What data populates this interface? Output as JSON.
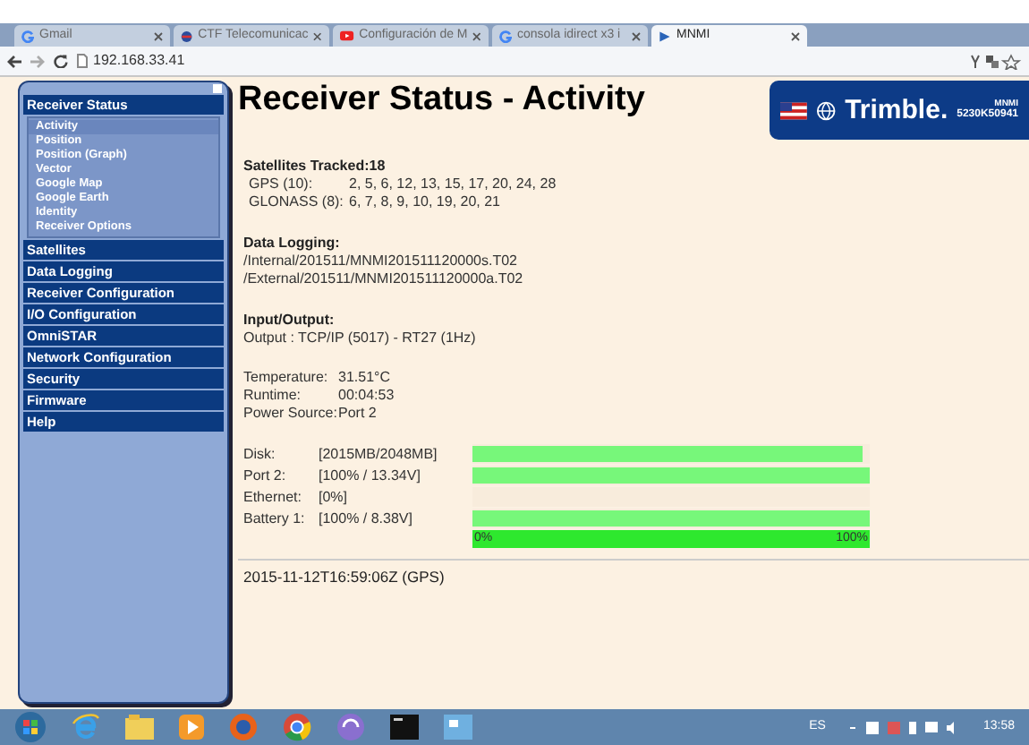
{
  "browser": {
    "tabs": [
      {
        "label": "Gmail",
        "kind": "g",
        "selected": false
      },
      {
        "label": "CTF Telecomunicac",
        "kind": "ctf",
        "selected": false
      },
      {
        "label": "Configuración de M",
        "kind": "video",
        "selected": false
      },
      {
        "label": "consola idirect x3 i",
        "kind": "g",
        "selected": false
      },
      {
        "label": "MNMI",
        "kind": "play",
        "selected": true
      }
    ],
    "address": "192.168.33.41"
  },
  "sidebar": {
    "sections": [
      {
        "label": "Receiver Status",
        "children": [
          {
            "label": "Activity",
            "selected": true
          },
          {
            "label": "Position",
            "selected": false
          },
          {
            "label": "Position (Graph)",
            "selected": false
          },
          {
            "label": "Vector",
            "selected": false
          },
          {
            "label": "Google Map",
            "selected": false
          },
          {
            "label": "Google Earth",
            "selected": false
          },
          {
            "label": "Identity",
            "selected": false
          },
          {
            "label": "Receiver Options",
            "selected": false
          }
        ]
      },
      {
        "label": "Satellites"
      },
      {
        "label": "Data Logging"
      },
      {
        "label": "Receiver Configuration"
      },
      {
        "label": "I/O Configuration"
      },
      {
        "label": "OmniSTAR"
      },
      {
        "label": "Network Configuration"
      },
      {
        "label": "Security"
      },
      {
        "label": "Firmware"
      },
      {
        "label": "Help"
      }
    ]
  },
  "page": {
    "title": "Receiver Status - Activity",
    "logo": {
      "brand": "Trimble.",
      "model": "MNMI",
      "serial": "5230K50941"
    },
    "satellites": {
      "heading": "Satellites Tracked:18",
      "rows": [
        {
          "label": "GPS (10):",
          "value": "2, 5, 6, 12, 13, 15, 17, 20, 24, 28"
        },
        {
          "label": "GLONASS (8):",
          "value": "6, 7, 8, 9, 10, 19, 20, 21"
        }
      ]
    },
    "data_logging": {
      "heading": "Data Logging:",
      "lines": [
        "/Internal/201511/MNMI201511120000s.T02",
        "/External/201511/MNMI201511120000a.T02"
      ]
    },
    "io": {
      "heading": "Input/Output:",
      "lines": [
        "Output : TCP/IP (5017) - RT27 (1Hz)"
      ]
    },
    "info": [
      {
        "label": "Temperature:",
        "value": "31.51°C"
      },
      {
        "label": "Runtime:",
        "value": "00:04:53"
      },
      {
        "label": "Power Source:",
        "value": "Port 2"
      }
    ],
    "meters": [
      {
        "label": "Disk:",
        "reading": "[2015MB/2048MB]",
        "level": 0.98
      },
      {
        "label": "Port 2:",
        "reading": "[100% / 13.34V]",
        "level": 1
      },
      {
        "label": "Ethernet:",
        "reading": "[0%]",
        "level": 0
      },
      {
        "label": "Battery 1:",
        "reading": "[100% / 8.38V]",
        "level": 1
      }
    ],
    "scale": {
      "min": "0%",
      "max": "100%"
    },
    "timestamp": "2015-11-12T16:59:06Z (GPS)"
  },
  "taskbar": {
    "language": "ES",
    "time": "13:58"
  }
}
